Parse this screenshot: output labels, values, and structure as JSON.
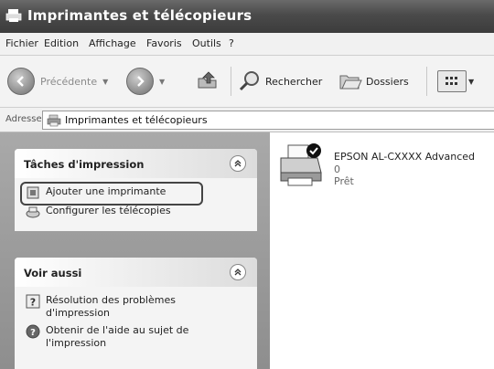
{
  "window": {
    "title": "Imprimantes et télécopieurs"
  },
  "menu": {
    "items": [
      "Fichier",
      "Edition",
      "Affichage",
      "Favoris",
      "Outils",
      "?"
    ]
  },
  "toolbar": {
    "back_label": "Précédente",
    "search_label": "Rechercher",
    "folders_label": "Dossiers"
  },
  "address": {
    "label": "Adresse",
    "value": "Imprimantes et télécopieurs"
  },
  "tasks_panel": {
    "title": "Tâches d'impression",
    "items": [
      "Ajouter une imprimante",
      "Configurer les télécopies"
    ]
  },
  "see_also_panel": {
    "title": "Voir aussi",
    "items": [
      "Résolution des problèmes d'impression",
      "Obtenir de l'aide au sujet de l'impression"
    ]
  },
  "printer": {
    "name": "EPSON AL-CXXXX Advanced",
    "jobs": "0",
    "status": "Prêt"
  },
  "colors": {
    "title_bar": "#4a4a4a",
    "pane_bg": "#9a9a9a",
    "highlight_border": "#444444"
  }
}
